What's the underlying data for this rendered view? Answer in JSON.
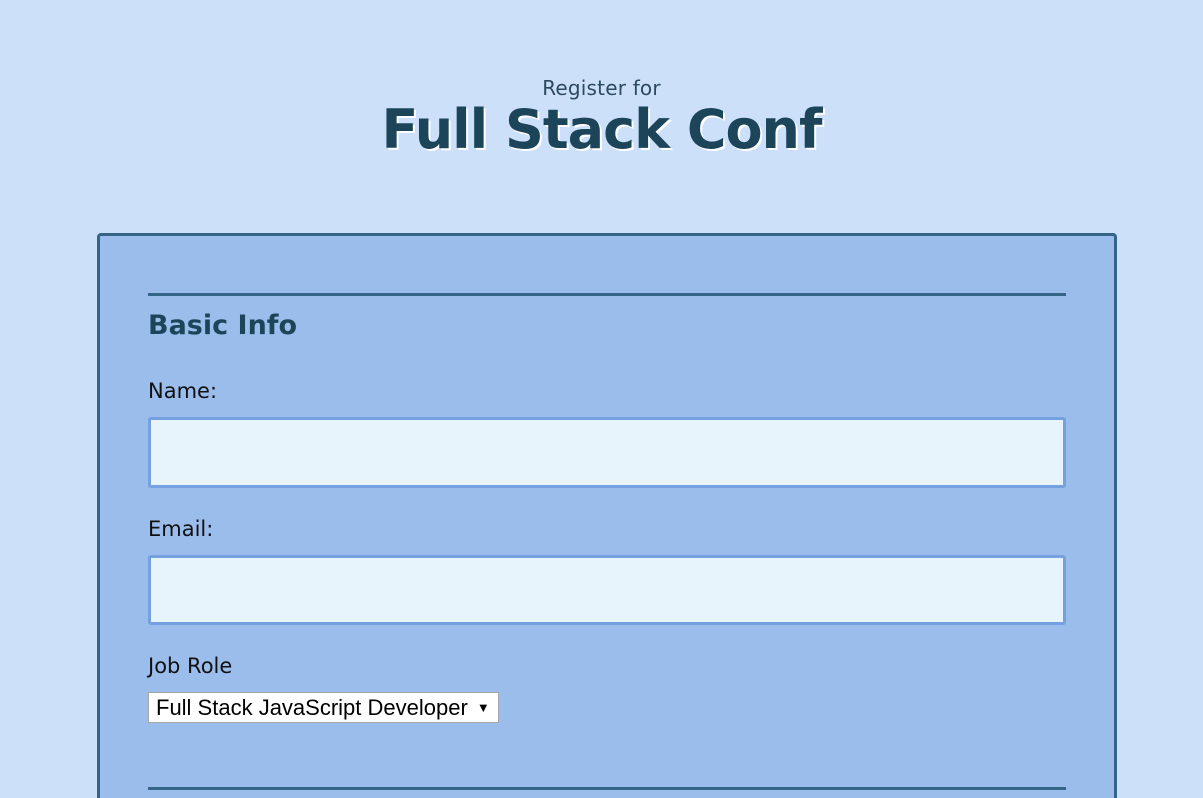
{
  "header": {
    "subtitle": "Register for",
    "title": "Full Stack Conf"
  },
  "form": {
    "section_title": "Basic Info",
    "name_label": "Name:",
    "name_value": "",
    "email_label": "Email:",
    "email_value": "",
    "job_role_label": "Job Role",
    "job_role_selected": "Full Stack JavaScript Developer",
    "dropdown_icon": "chevron-down-icon"
  },
  "colors": {
    "page_background": "#cce0fa",
    "card_background": "#9bbdec",
    "card_border": "#356586",
    "heading": "#1c4559",
    "input_background": "#e8f4fb",
    "input_border": "#76a1e0"
  }
}
